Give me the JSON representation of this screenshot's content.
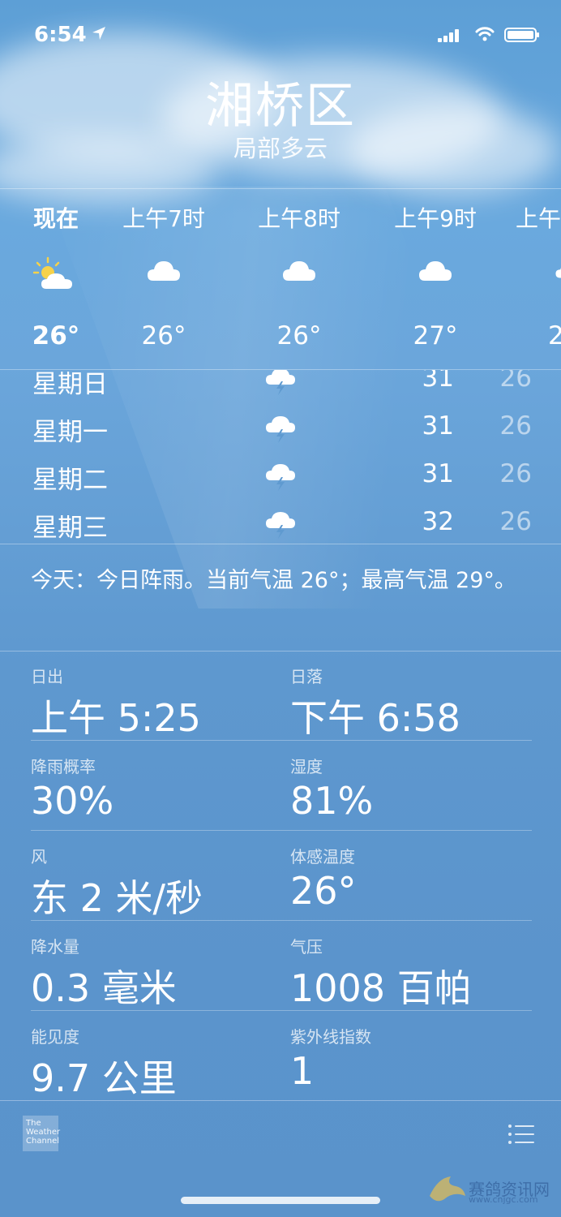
{
  "status_bar": {
    "time": "6:54"
  },
  "location": {
    "city": "湘桥区",
    "condition": "局部多云"
  },
  "hourly": [
    {
      "label": "现在",
      "icon": "partly-sunny-icon",
      "temp": "26°"
    },
    {
      "label": "上午7时",
      "icon": "cloud-icon",
      "temp": "26°"
    },
    {
      "label": "上午8时",
      "icon": "cloud-icon",
      "temp": "26°"
    },
    {
      "label": "上午9时",
      "icon": "cloud-icon",
      "temp": "27°"
    },
    {
      "label": "上午",
      "icon": "cloud-icon",
      "temp": "2"
    }
  ],
  "daily": [
    {
      "day": "星期日",
      "icon": "thunderstorm-icon",
      "high": "31",
      "low": "26"
    },
    {
      "day": "星期一",
      "icon": "thunderstorm-icon",
      "high": "31",
      "low": "26"
    },
    {
      "day": "星期二",
      "icon": "thunderstorm-icon",
      "high": "31",
      "low": "26"
    },
    {
      "day": "星期三",
      "icon": "thunderstorm-icon",
      "high": "32",
      "low": "26"
    }
  ],
  "summary": "今天：今日阵雨。当前气温 26°；最高气温 29°。",
  "details": {
    "sunrise": {
      "label": "日出",
      "value": "上午 5:25"
    },
    "sunset": {
      "label": "日落",
      "value": "下午 6:58"
    },
    "rain_chance": {
      "label": "降雨概率",
      "value": "30%"
    },
    "humidity": {
      "label": "湿度",
      "value": "81%"
    },
    "wind": {
      "label": "风",
      "value": "东 2 米/秒"
    },
    "feels_like": {
      "label": "体感温度",
      "value": "26°"
    },
    "precipitation": {
      "label": "降水量",
      "value": "0.3 毫米"
    },
    "pressure": {
      "label": "气压",
      "value": "1008 百帕"
    },
    "visibility": {
      "label": "能见度",
      "value": "9.7 公里"
    },
    "uv_index": {
      "label": "紫外线指数",
      "value": "1"
    }
  },
  "footer": {
    "logo_text": "The Weather Channel",
    "watermark": "赛鸽资讯网",
    "watermark_url": "www.cnjgc.com"
  },
  "colors": {
    "sky_top": "#5d9fd6",
    "sky_bottom": "#5a93cb",
    "text": "#ffffff"
  }
}
